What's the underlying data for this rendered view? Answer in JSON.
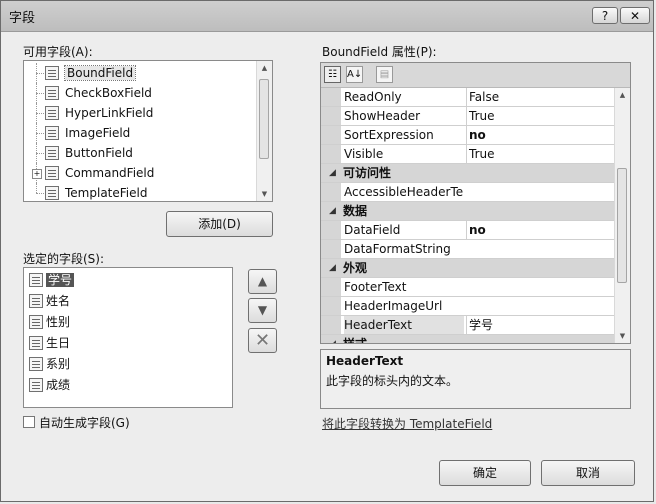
{
  "window": {
    "title": "字段",
    "help_label": "?",
    "close_label": "✕"
  },
  "available_fields": {
    "label": "可用字段(A):",
    "items": [
      {
        "label": "BoundField",
        "icon": "bound-field-icon"
      },
      {
        "label": "CheckBoxField",
        "icon": "checkbox-field-icon"
      },
      {
        "label": "HyperLinkField",
        "icon": "hyperlink-field-icon"
      },
      {
        "label": "ImageField",
        "icon": "image-field-icon"
      },
      {
        "label": "ButtonField",
        "icon": "button-field-icon"
      },
      {
        "label": "CommandField",
        "icon": "command-field-icon"
      },
      {
        "label": "TemplateField",
        "icon": "template-field-icon"
      }
    ]
  },
  "add_button": "添加(D)",
  "selected_fields": {
    "label": "选定的字段(S):",
    "items": [
      "学号",
      "姓名",
      "性别",
      "生日",
      "系别",
      "成绩"
    ]
  },
  "auto_generate_label": "自动生成字段(G)",
  "properties": {
    "label": "BoundField 属性(P):",
    "rows": [
      {
        "name": "ReadOnly",
        "value": "False"
      },
      {
        "name": "ShowHeader",
        "value": "True"
      },
      {
        "name": "SortExpression",
        "value": "no"
      },
      {
        "name": "Visible",
        "value": "True"
      },
      {
        "category": "可访问性"
      },
      {
        "name": "AccessibleHeaderTe",
        "value": ""
      },
      {
        "category": "数据"
      },
      {
        "name": "DataField",
        "value": "no"
      },
      {
        "name": "DataFormatString",
        "value": ""
      },
      {
        "category": "外观"
      },
      {
        "name": "FooterText",
        "value": ""
      },
      {
        "name": "HeaderImageUrl",
        "value": ""
      },
      {
        "name": "HeaderText",
        "value": "学号"
      },
      {
        "category": "样式"
      }
    ],
    "description_title": "HeaderText",
    "description_text": "此字段的标头内的文本。"
  },
  "convert_link": "将此字段转换为 TemplateField",
  "ok_button": "确定",
  "cancel_button": "取消"
}
